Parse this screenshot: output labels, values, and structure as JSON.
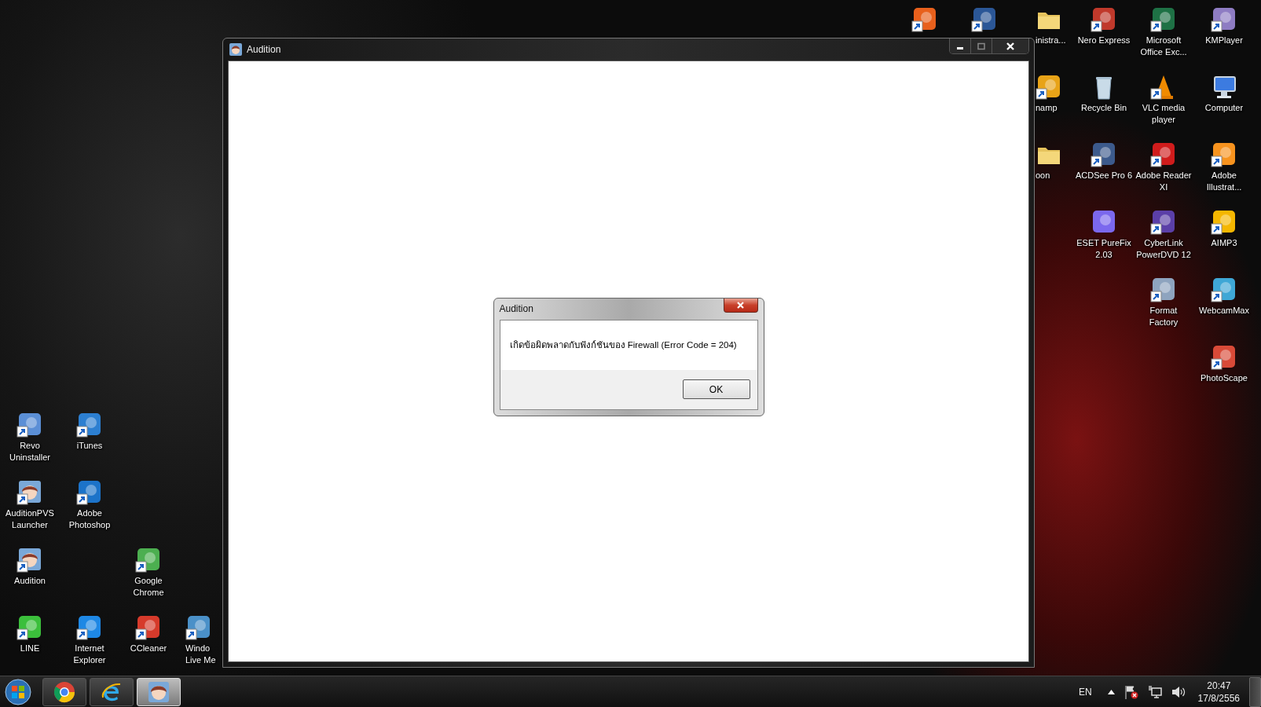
{
  "desktop_icons": [
    {
      "kind": "app",
      "color": "#e8601c",
      "shortcut": true
    },
    {
      "kind": "app",
      "color": "#2b5797",
      "shortcut": true
    },
    {
      "label": "inistra...",
      "kind": "folder",
      "shortcut": false
    },
    {
      "label": "Nero Express",
      "kind": "app",
      "color": "#c0392b",
      "shortcut": true
    },
    {
      "label": "Microsoft Office Exc...",
      "kind": "app",
      "color": "#1e7145",
      "shortcut": true
    },
    {
      "label": "KMPlayer",
      "kind": "app",
      "color": "#8e7cc3",
      "shortcut": true
    },
    {
      "label": "namp",
      "kind": "app",
      "color": "#e8a317",
      "shortcut": true
    },
    {
      "label": "Recycle Bin",
      "kind": "bin",
      "shortcut": false
    },
    {
      "label": "VLC media player",
      "kind": "cone",
      "color": "#f08a00",
      "shortcut": true
    },
    {
      "label": "Computer",
      "kind": "computer",
      "shortcut": false
    },
    {
      "label": "oon",
      "kind": "folder",
      "shortcut": false
    },
    {
      "label": "ACDSee Pro 6",
      "kind": "app",
      "color": "#3c5a8c",
      "shortcut": true
    },
    {
      "label": "Adobe Reader XI",
      "kind": "app",
      "color": "#d01c1c",
      "shortcut": true
    },
    {
      "label": "Adobe Illustrat...",
      "kind": "app",
      "color": "#f7931e",
      "shortcut": true
    },
    {
      "label": "ESET PureFix 2.03",
      "kind": "app",
      "color": "#7b68ee",
      "shortcut": false
    },
    {
      "label": "CyberLink PowerDVD 12",
      "kind": "app",
      "color": "#5b3fa8",
      "shortcut": true
    },
    {
      "label": "AIMP3",
      "kind": "app",
      "color": "#f5b700",
      "shortcut": true
    },
    {
      "label": "Format Factory",
      "kind": "app",
      "color": "#8ea4bf",
      "shortcut": true
    },
    {
      "label": "WebcamMax",
      "kind": "app",
      "color": "#3fa7d6",
      "shortcut": true
    },
    {
      "label": "PhotoScape",
      "kind": "app",
      "color": "#d94a38",
      "shortcut": true
    },
    {
      "label": "Revo Uninstaller",
      "kind": "app",
      "color": "#5b8fd6",
      "shortcut": true
    },
    {
      "label": "iTunes",
      "kind": "app",
      "color": "#2c7fd1",
      "shortcut": true
    },
    {
      "label": "AuditionPVS Launcher",
      "kind": "character",
      "shortcut": true
    },
    {
      "label": "Adobe Photoshop",
      "kind": "app",
      "color": "#1c73c9",
      "shortcut": true
    },
    {
      "label": "Audition",
      "kind": "character",
      "shortcut": true
    },
    {
      "label": "Google Chrome",
      "kind": "app",
      "color": "#4caf50",
      "shortcut": true
    },
    {
      "label": "LINE",
      "kind": "app",
      "color": "#3bbf3b",
      "shortcut": true
    },
    {
      "label": "Internet Explorer",
      "kind": "app",
      "color": "#1e88e5",
      "shortcut": true
    },
    {
      "label": "CCleaner",
      "kind": "app",
      "color": "#d63a2b",
      "shortcut": true
    },
    {
      "label": "Windo Live Me",
      "kind": "app",
      "color": "#4a90c8",
      "shortcut": true
    }
  ],
  "window": {
    "title": "Audition"
  },
  "dialog": {
    "title": "Audition",
    "message": "เกิดข้อผิดพลาดกับฟังก์ชันของ Firewall (Error Code = 204)",
    "button": "OK"
  },
  "taskbar": {
    "buttons": [
      {
        "kind": "ball",
        "active": false
      },
      {
        "kind": "e-logo",
        "active": false
      },
      {
        "kind": "character",
        "active": true
      }
    ],
    "language": "EN",
    "time": "20:47",
    "date": "17/8/2556"
  }
}
